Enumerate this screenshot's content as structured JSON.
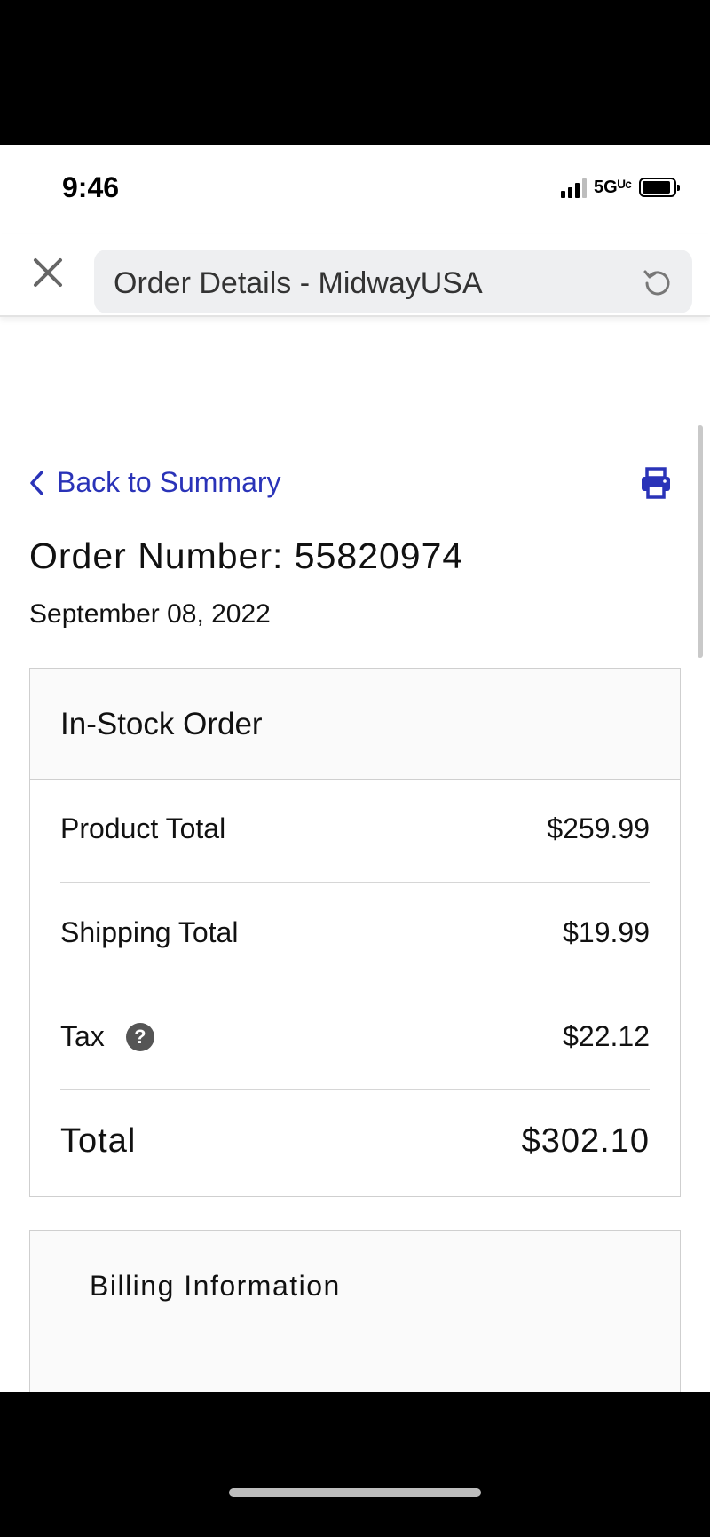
{
  "status_bar": {
    "time": "9:46",
    "network": "5Gᵁᶜ"
  },
  "browser": {
    "page_title": "Order Details - MidwayUSA",
    "close_icon": "close-icon",
    "reload_icon": "reload-icon"
  },
  "page": {
    "back_link": "Back to Summary",
    "order_number": "Order Number: 55820974",
    "order_date": "September 08, 2022",
    "accent_color": "#2a33b8"
  },
  "order_summary": {
    "title": "In-Stock Order",
    "rows": [
      {
        "label": "Product Total",
        "value": "$259.99"
      },
      {
        "label": "Shipping Total",
        "value": "$19.99"
      },
      {
        "label": "Tax",
        "value": "$22.12",
        "help_icon": "?"
      },
      {
        "label": "Total",
        "value": "$302.10"
      }
    ]
  },
  "billing": {
    "title": "Billing Information"
  }
}
